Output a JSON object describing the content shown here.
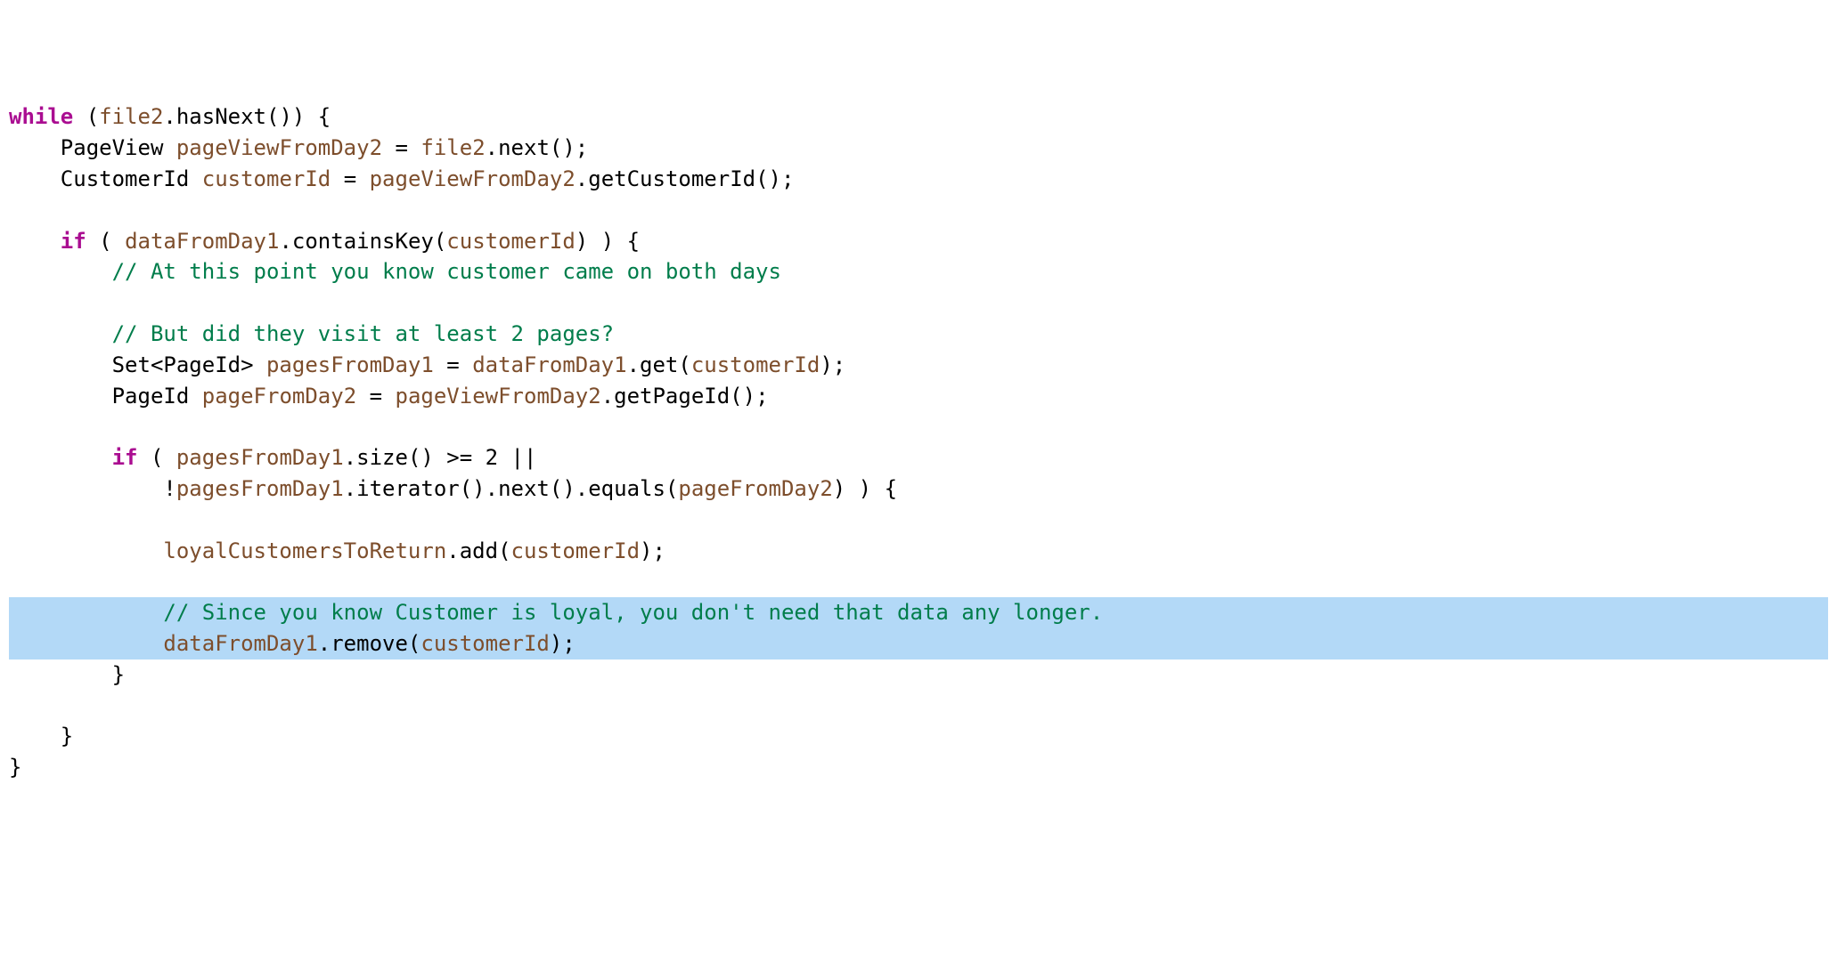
{
  "code": {
    "tokens": [
      [
        {
          "t": "while",
          "c": "kw"
        },
        {
          "t": " (",
          "c": ""
        },
        {
          "t": "file2",
          "c": "id"
        },
        {
          "t": ".hasNext()) {",
          "c": ""
        }
      ],
      [
        {
          "t": "    PageView ",
          "c": ""
        },
        {
          "t": "pageViewFromDay2",
          "c": "id"
        },
        {
          "t": " = ",
          "c": ""
        },
        {
          "t": "file2",
          "c": "id"
        },
        {
          "t": ".next();",
          "c": ""
        }
      ],
      [
        {
          "t": "    CustomerId ",
          "c": ""
        },
        {
          "t": "customerId",
          "c": "id"
        },
        {
          "t": " = ",
          "c": ""
        },
        {
          "t": "pageViewFromDay2",
          "c": "id"
        },
        {
          "t": ".getCustomerId();",
          "c": ""
        }
      ],
      [
        {
          "t": "",
          "c": ""
        }
      ],
      [
        {
          "t": "    ",
          "c": ""
        },
        {
          "t": "if",
          "c": "kw"
        },
        {
          "t": " ( ",
          "c": ""
        },
        {
          "t": "dataFromDay1",
          "c": "id"
        },
        {
          "t": ".containsKey(",
          "c": ""
        },
        {
          "t": "customerId",
          "c": "id"
        },
        {
          "t": ") ) {",
          "c": ""
        }
      ],
      [
        {
          "t": "        ",
          "c": ""
        },
        {
          "t": "// At this point you know customer came on both days",
          "c": "cm"
        }
      ],
      [
        {
          "t": "",
          "c": ""
        }
      ],
      [
        {
          "t": "        ",
          "c": ""
        },
        {
          "t": "// But did they visit at least 2 pages?",
          "c": "cm"
        }
      ],
      [
        {
          "t": "        Set<PageId> ",
          "c": ""
        },
        {
          "t": "pagesFromDay1",
          "c": "id"
        },
        {
          "t": " = ",
          "c": ""
        },
        {
          "t": "dataFromDay1",
          "c": "id"
        },
        {
          "t": ".get(",
          "c": ""
        },
        {
          "t": "customerId",
          "c": "id"
        },
        {
          "t": ");",
          "c": ""
        }
      ],
      [
        {
          "t": "        PageId ",
          "c": ""
        },
        {
          "t": "pageFromDay2",
          "c": "id"
        },
        {
          "t": " = ",
          "c": ""
        },
        {
          "t": "pageViewFromDay2",
          "c": "id"
        },
        {
          "t": ".getPageId();",
          "c": ""
        }
      ],
      [
        {
          "t": "",
          "c": ""
        }
      ],
      [
        {
          "t": "        ",
          "c": ""
        },
        {
          "t": "if",
          "c": "kw"
        },
        {
          "t": " ( ",
          "c": ""
        },
        {
          "t": "pagesFromDay1",
          "c": "id"
        },
        {
          "t": ".size() >= 2 ||",
          "c": ""
        }
      ],
      [
        {
          "t": "            !",
          "c": ""
        },
        {
          "t": "pagesFromDay1",
          "c": "id"
        },
        {
          "t": ".iterator().next().equals(",
          "c": ""
        },
        {
          "t": "pageFromDay2",
          "c": "id"
        },
        {
          "t": ") ) {",
          "c": ""
        }
      ],
      [
        {
          "t": "",
          "c": ""
        }
      ],
      [
        {
          "t": "            ",
          "c": ""
        },
        {
          "t": "loyalCustomersToReturn",
          "c": "id"
        },
        {
          "t": ".add(",
          "c": ""
        },
        {
          "t": "customerId",
          "c": "id"
        },
        {
          "t": ");",
          "c": ""
        }
      ],
      [
        {
          "t": "",
          "c": ""
        }
      ],
      [
        {
          "t": "            ",
          "c": ""
        },
        {
          "t": "// Since you know Customer is loyal, you don't need that data any longer.",
          "c": "cm"
        }
      ],
      [
        {
          "t": "            ",
          "c": ""
        },
        {
          "t": "dataFromDay1",
          "c": "id"
        },
        {
          "t": ".remove(",
          "c": ""
        },
        {
          "t": "customerId",
          "c": "id"
        },
        {
          "t": ");",
          "c": ""
        }
      ],
      [
        {
          "t": "        }",
          "c": ""
        }
      ],
      [
        {
          "t": "",
          "c": ""
        }
      ],
      [
        {
          "t": "    }",
          "c": ""
        }
      ],
      [
        {
          "t": "}",
          "c": ""
        }
      ]
    ],
    "highlighted_lines": [
      16,
      17
    ]
  }
}
